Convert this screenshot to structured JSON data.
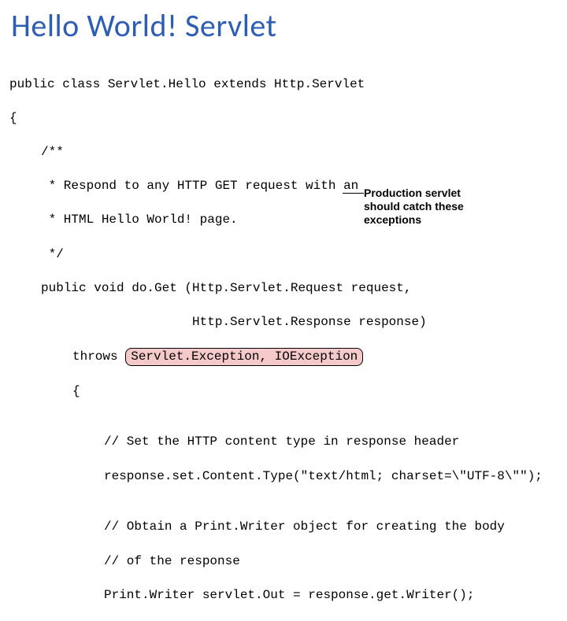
{
  "title": "Hello World! Servlet",
  "code": {
    "l1": "public class Servlet.Hello extends Http.Servlet",
    "l2": "{",
    "l3": "/**",
    "l4": " * Respond to any HTTP GET request with an",
    "l5": " * HTML Hello World! page.",
    "l6": " */",
    "l7": "public void do.Get (Http.Servlet.Request request,",
    "l8": "                    Http.Servlet.Response response)",
    "l9a": "throws ",
    "l9b": "Servlet.Exception, IOException",
    "l10": "{",
    "blank1": "",
    "l11": "// Set the HTTP content type in response header",
    "l12": "response.set.Content.Type(\"text/html; charset=\\\"UTF-8\\\"\");",
    "blank2": "",
    "l13": "// Obtain a Print.Writer object for creating the body",
    "l14": "// of the response",
    "l15": "Print.Writer servlet.Out = response.get.Writer();"
  },
  "annotation": "Production servlet should catch these exceptions"
}
